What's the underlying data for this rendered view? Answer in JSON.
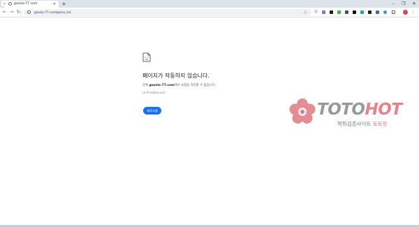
{
  "browser": {
    "tab_title": "gosolo-77.com",
    "new_tab_symbol": "+",
    "close_symbol": "✕",
    "url": "gosolo-77.com/game_list",
    "window_controls": [
      "–",
      "❐",
      "✕"
    ]
  },
  "error_page": {
    "title": "페이지가 작동하지 않습니다.",
    "desc_host": "gosolo-77.com",
    "desc_rest": "에서 요청을 처리할 수 없습니다.",
    "desc_prefix": "현재",
    "code": "HTTP ERROR 502",
    "reload_label": "새로고침"
  },
  "watermark": {
    "brand_part1": "TOTO",
    "brand_part2": "HOT",
    "tagline_part1": "먹튀검증사이트 ",
    "tagline_part2": "토토핫"
  },
  "colors": {
    "accent": "#1a73e8",
    "watermark_red": "#e0636e"
  }
}
